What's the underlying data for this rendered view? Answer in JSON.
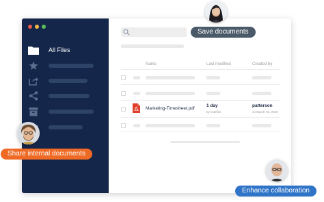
{
  "colors": {
    "sidebar_bg": "#14264a",
    "dot_red": "#e95c4b",
    "dot_yellow": "#f2b94a",
    "dot_green": "#5cc05a",
    "pill_dark": "#4a5a68",
    "pill_orange": "#ee6a25",
    "pill_blue": "#2f74c7",
    "pdf_red": "#e0402b"
  },
  "sidebar": {
    "active_item": {
      "label": "All Files",
      "icon": "folder-icon"
    },
    "icons": [
      "star-icon",
      "share-icon",
      "network-share-icon",
      "archive-icon",
      "folder-icon"
    ]
  },
  "table": {
    "columns": [
      "Name",
      "Last modified",
      "Created by"
    ],
    "file_row": {
      "name": "Marketing-Timesheet.pdf",
      "modified": "1 day",
      "modified_by": "by estefine",
      "created_by": "patterson",
      "created_date": "on March 01, 2020"
    }
  },
  "callouts": {
    "save": "Save documents",
    "share": "Share internal documents",
    "collab": "Enhance collaboration"
  }
}
